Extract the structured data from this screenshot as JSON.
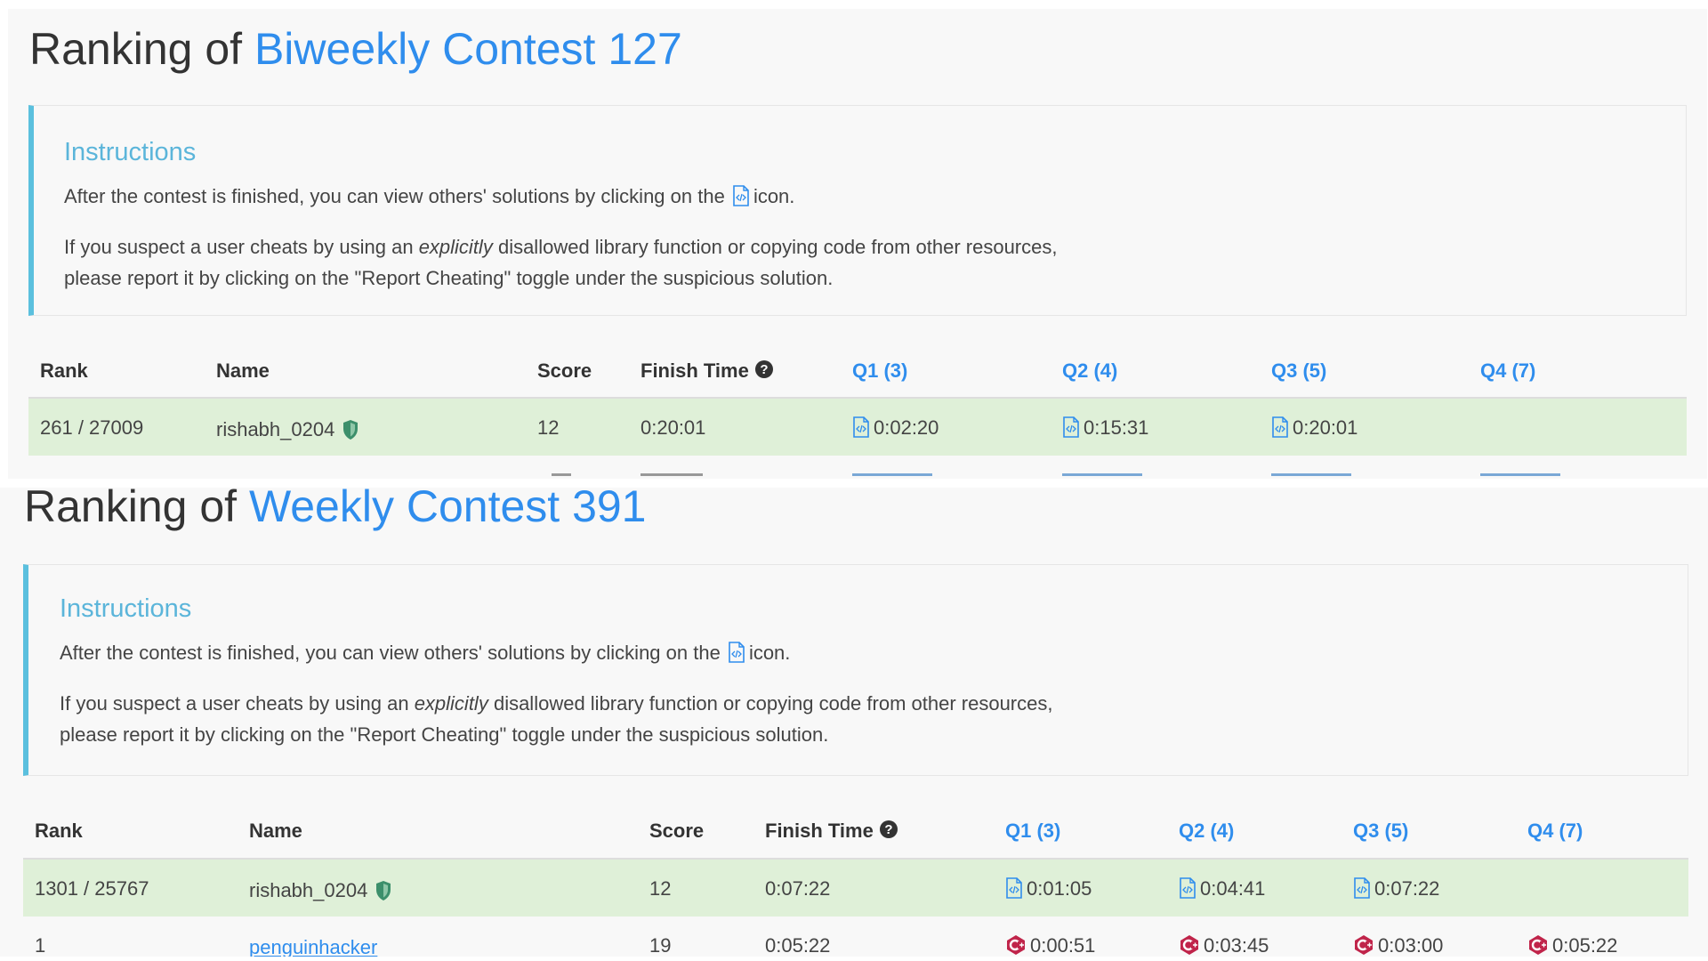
{
  "contests": [
    {
      "title_prefix": "Ranking of",
      "contest_name": "Biweekly Contest 127",
      "instructions": {
        "heading": "Instructions",
        "line1_before": "After the contest is finished, you can view others' solutions by clicking on the",
        "line1_after": "icon.",
        "line2_a": "If you suspect a user cheats by using an",
        "line2_em": "explicitly",
        "line2_b": "disallowed library function or copying code from other resources,",
        "line3": "please report it by clicking on the \"Report Cheating\" toggle under the suspicious solution."
      },
      "columns": {
        "rank": "Rank",
        "name": "Name",
        "score": "Score",
        "finish_time": "Finish Time",
        "q1": "Q1 (3)",
        "q2": "Q2 (4)",
        "q3": "Q3 (5)",
        "q4": "Q4 (7)"
      },
      "user_row": {
        "rank": "261 / 27009",
        "name": "rishabh_0204",
        "score": "12",
        "finish_time": "0:20:01",
        "q1": "0:02:20",
        "q2": "0:15:31",
        "q3": "0:20:01",
        "q4": ""
      }
    },
    {
      "title_prefix": "Ranking of",
      "contest_name": "Weekly Contest 391",
      "instructions": {
        "heading": "Instructions",
        "line1_before": "After the contest is finished, you can view others' solutions by clicking on the",
        "line1_after": "icon.",
        "line2_a": "If you suspect a user cheats by using an",
        "line2_em": "explicitly",
        "line2_b": "disallowed library function or copying code from other resources,",
        "line3": "please report it by clicking on the \"Report Cheating\" toggle under the suspicious solution."
      },
      "columns": {
        "rank": "Rank",
        "name": "Name",
        "score": "Score",
        "finish_time": "Finish Time",
        "q1": "Q1 (3)",
        "q2": "Q2 (4)",
        "q3": "Q3 (5)",
        "q4": "Q4 (7)"
      },
      "user_row": {
        "rank": "1301 / 25767",
        "name": "rishabh_0204",
        "score": "12",
        "finish_time": "0:07:22",
        "q1": "0:01:05",
        "q2": "0:04:41",
        "q3": "0:07:22",
        "q4": ""
      },
      "next_row": {
        "rank": "1",
        "name": "penguinhacker",
        "score": "19",
        "finish_time": "0:05:22",
        "q1": "0:00:51",
        "q2": "0:03:45",
        "q3": "0:03:00",
        "q4": "0:05:22"
      }
    }
  ],
  "colors": {
    "contest_link": "#2f8ded",
    "instructions_heading": "#5bb5da",
    "callout_border": "#5bc0de",
    "highlight_row": "#dff0d8",
    "cpp_badge": "#c0244a"
  }
}
